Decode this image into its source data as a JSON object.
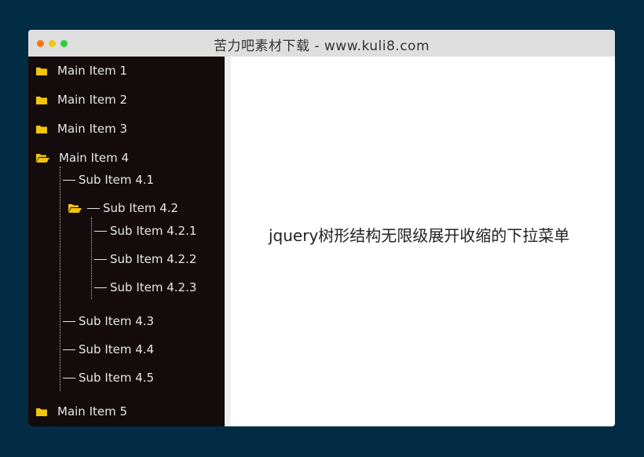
{
  "window": {
    "title": "苦力吧素材下载 - www.kuli8.com",
    "buttons": [
      "close",
      "minimize",
      "maximize"
    ]
  },
  "colors": {
    "background": "#022c44",
    "sidebar": "#140c0c",
    "folder": "#f1c40f",
    "text": "#e6e6e6"
  },
  "tree": {
    "main_items": [
      {
        "label": "Main Item 1",
        "icon": "folder-closed-icon"
      },
      {
        "label": "Main Item 2",
        "icon": "folder-closed-icon"
      },
      {
        "label": "Main Item 3",
        "icon": "folder-closed-icon"
      },
      {
        "label": "Main Item 4",
        "icon": "folder-open-icon"
      },
      {
        "label": "Main Item 5",
        "icon": "folder-closed-icon"
      }
    ],
    "sub_items": [
      {
        "label": "Sub Item 4.1"
      },
      {
        "label": "Sub Item 4.2",
        "icon": "folder-open-icon"
      },
      {
        "label": "Sub Item 4.3"
      },
      {
        "label": "Sub Item 4.4"
      },
      {
        "label": "Sub Item 4.5"
      }
    ],
    "sub_sub_items": [
      {
        "label": "Sub Item 4.2.1"
      },
      {
        "label": "Sub Item 4.2.2"
      },
      {
        "label": "Sub Item 4.2.3"
      }
    ]
  },
  "content": {
    "text": "jquery树形结构无限级展开收缩的下拉菜单"
  }
}
